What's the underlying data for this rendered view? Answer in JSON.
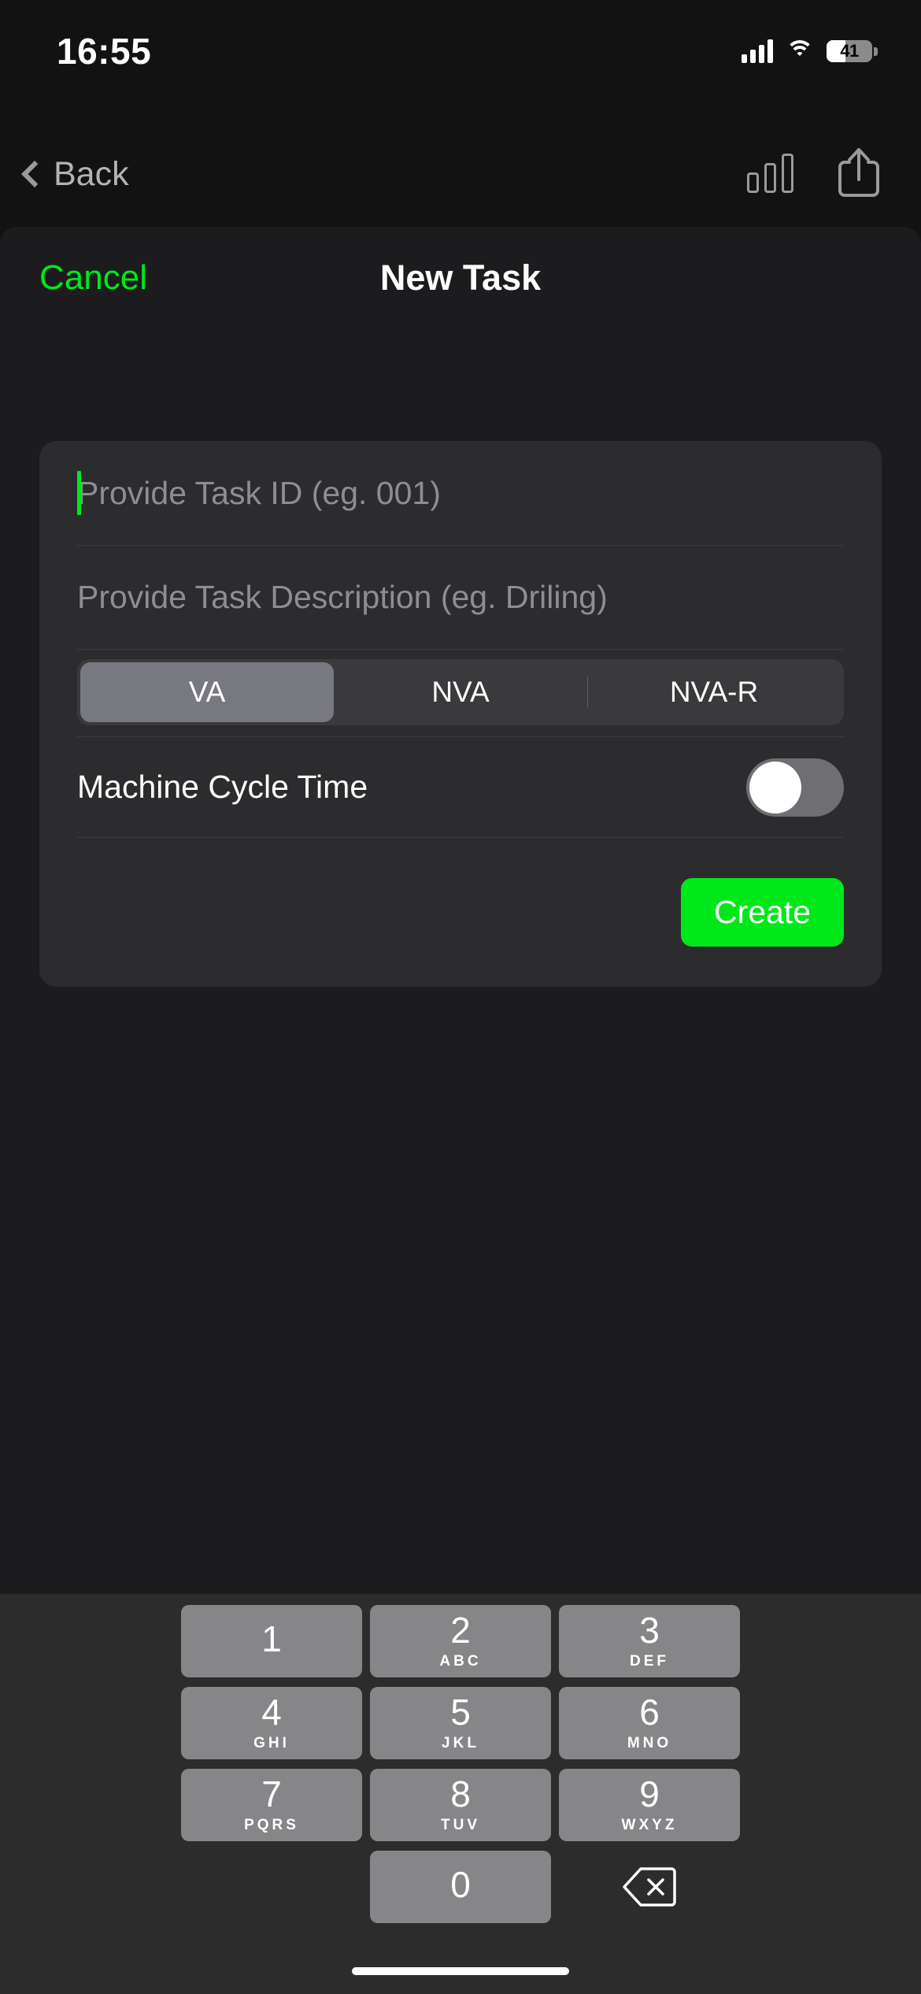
{
  "status_bar": {
    "time": "16:55",
    "battery_percent": "41",
    "signal_icon": "cellular-signal-icon",
    "wifi_icon": "wifi-icon",
    "battery_icon": "battery-icon"
  },
  "nav_bar": {
    "back_label": "Back",
    "back_icon": "chevron-left-icon",
    "chart_icon": "bar-chart-icon",
    "share_icon": "share-icon"
  },
  "sheet": {
    "cancel_label": "Cancel",
    "title": "New Task",
    "accent_color": "#00e81a"
  },
  "form": {
    "task_id": {
      "value": "",
      "placeholder": "Provide Task ID (eg. 001)"
    },
    "task_description": {
      "value": "",
      "placeholder": "Provide Task Description (eg. Driling)"
    },
    "segmented": {
      "options": [
        "VA",
        "NVA",
        "NVA-R"
      ],
      "selected": "VA"
    },
    "machine_cycle_time": {
      "label": "Machine Cycle Time",
      "enabled": false
    },
    "create_label": "Create"
  },
  "keyboard": {
    "type": "numeric-keypad",
    "keys": [
      {
        "num": "1",
        "sub": ""
      },
      {
        "num": "2",
        "sub": "ABC"
      },
      {
        "num": "3",
        "sub": "DEF"
      },
      {
        "num": "4",
        "sub": "GHI"
      },
      {
        "num": "5",
        "sub": "JKL"
      },
      {
        "num": "6",
        "sub": "MNO"
      },
      {
        "num": "7",
        "sub": "PQRS"
      },
      {
        "num": "8",
        "sub": "TUV"
      },
      {
        "num": "9",
        "sub": "WXYZ"
      },
      {
        "num": "0",
        "sub": ""
      }
    ],
    "backspace_icon": "backspace-icon"
  }
}
